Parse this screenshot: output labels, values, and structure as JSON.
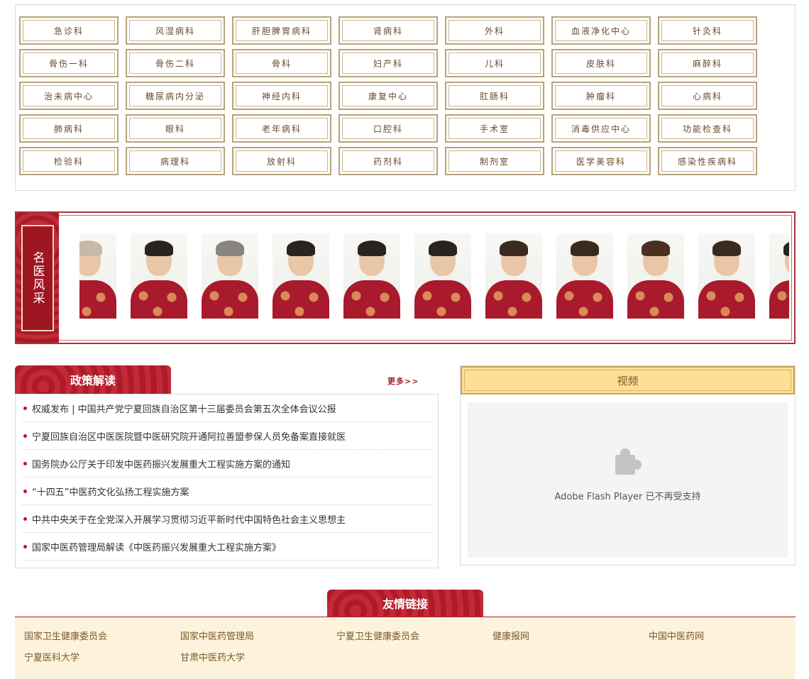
{
  "departments": [
    [
      "急诊科",
      "风湿病科",
      "肝胆脾胃病科",
      "肾病科",
      "外科",
      "血液净化中心",
      "针灸科"
    ],
    [
      "骨伤一科",
      "骨伤二科",
      "骨科",
      "妇产科",
      "儿科",
      "皮肤科",
      "麻醉科"
    ],
    [
      "治未病中心",
      "糖尿病内分泌",
      "神经内科",
      "康复中心",
      "肛肠科",
      "肿瘤科",
      "心病科"
    ],
    [
      "肺病科",
      "眼科",
      "老年病科",
      "口腔科",
      "手术室",
      "消毒供应中心",
      "功能检查科"
    ],
    [
      "检验科",
      "病理科",
      "放射科",
      "药剂科",
      "制剂室",
      "医学美容科",
      "感染性疾病科"
    ]
  ],
  "doctors": {
    "title": "名医风采",
    "portraits": [
      {
        "hair": "#c9b8a8"
      },
      {
        "hair": "#2a2420"
      },
      {
        "hair": "#8a8480"
      },
      {
        "hair": "#2a2420"
      },
      {
        "hair": "#2a2420"
      },
      {
        "hair": "#2a2420"
      },
      {
        "hair": "#3a2a20"
      },
      {
        "hair": "#3a2a20"
      },
      {
        "hair": "#4a3020"
      },
      {
        "hair": "#3a2a20"
      },
      {
        "hair": "#2a2420"
      }
    ]
  },
  "policy": {
    "title": "政策解读",
    "more": "更多>>",
    "items": [
      "权威发布 | 中国共产党宁夏回族自治区第十三届委员会第五次全体会议公报",
      "宁夏回族自治区中医医院暨中医研究院开通阿拉善盟参保人员免备案直接就医",
      "国务院办公厅关于印发中医药振兴发展重大工程实施方案的通知",
      "“十四五”中医药文化弘扬工程实施方案",
      "中共中央关于在全党深入开展学习贯彻习近平新时代中国特色社会主义思想主",
      "国家中医药管理局解读《中医药振兴发展重大工程实施方案》"
    ]
  },
  "video": {
    "title": "视频",
    "flash_message": "Adobe Flash Player 已不再受支持",
    "icon": "puzzle-piece-icon"
  },
  "links": {
    "title": "友情链接",
    "items": [
      "国家卫生健康委员会",
      "国家中医药管理局",
      "宁夏卫生健康委员会",
      "健康报网",
      "中国中医药网",
      "宁夏医科大学",
      "甘肃中医药大学"
    ]
  }
}
